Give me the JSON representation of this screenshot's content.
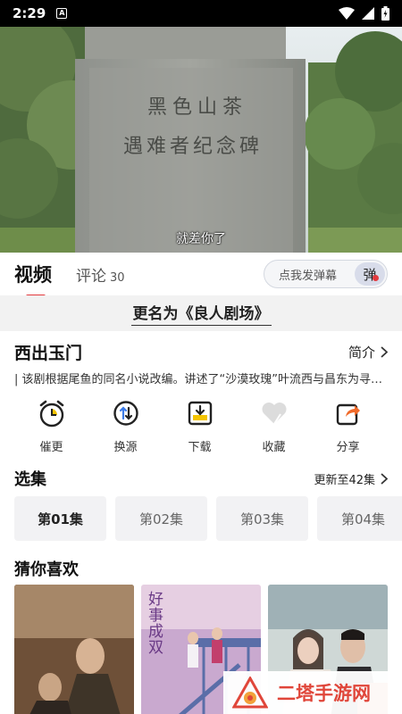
{
  "status_bar": {
    "time": "2:29",
    "notif_letter": "A"
  },
  "video": {
    "subtitle": "就差你了",
    "monument_text": [
      "黑色山茶",
      "遇难者纪念碑"
    ]
  },
  "tabs": {
    "video_label": "视频",
    "comment_label": "评论",
    "comment_count": "30",
    "danmu_placeholder": "点我发弹幕",
    "danmu_button": "弹"
  },
  "notice": {
    "text": "更名为《良人剧场》"
  },
  "show": {
    "title": "西出玉门",
    "intro_label": "简介",
    "description": "| 该剧根据尾鱼的同名小说改编。讲述了“沙漠玫瑰”叶流西与昌东为寻找被遗忘的过去与真相而穿越玉门关外无人区的故事"
  },
  "actions": [
    {
      "label": "催更",
      "icon": "alarm-clock-icon"
    },
    {
      "label": "换源",
      "icon": "switch-source-icon"
    },
    {
      "label": "下载",
      "icon": "download-icon"
    },
    {
      "label": "收藏",
      "icon": "heart-icon"
    },
    {
      "label": "分享",
      "icon": "share-icon"
    }
  ],
  "episodes": {
    "heading": "选集",
    "update_text": "更新至42集",
    "items": [
      "第01集",
      "第02集",
      "第03集",
      "第04集"
    ]
  },
  "recommend": {
    "heading": "猜你喜欢",
    "poster2_title": "好事成双"
  },
  "watermark": {
    "text": "二塔手游网"
  },
  "colors": {
    "accent": "#e23a3e",
    "watermark": "#e0463a",
    "chip_bg": "#f2f2f4"
  }
}
